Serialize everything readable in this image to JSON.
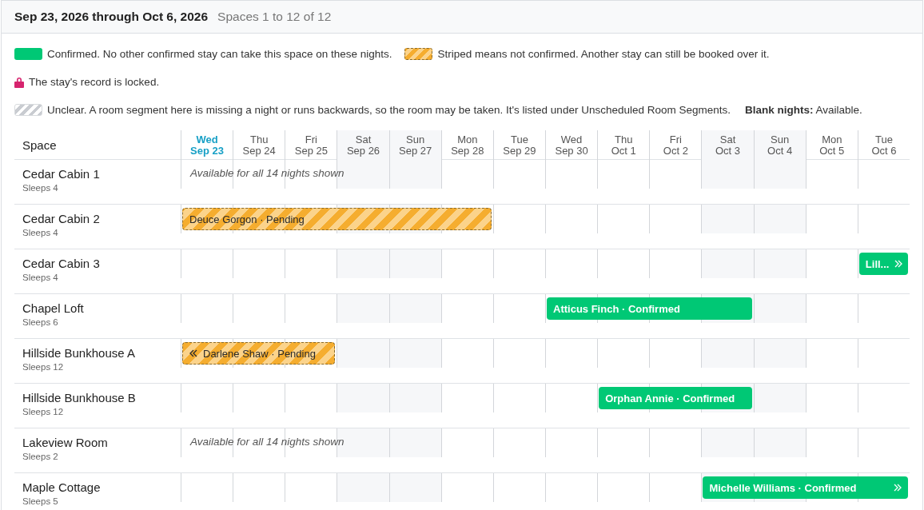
{
  "header": {
    "range": "Sep 23, 2026 through Oct 6, 2026",
    "count": "Spaces 1 to 12 of 12"
  },
  "legend": [
    [
      {
        "kind": "confirmed",
        "text": "Confirmed. No other confirmed stay can take this space on these nights."
      },
      {
        "kind": "pending",
        "text": "Striped means not confirmed. Another stay can still be booked over it."
      }
    ],
    [
      {
        "kind": "locked",
        "text": "The stay's record is locked."
      }
    ],
    [
      {
        "kind": "unclear",
        "text": "Unclear. A room segment here is missing a night or runs backwards, so the room may be taken. It's listed under Unscheduled Room Segments."
      },
      {
        "kind": "note",
        "text": "**Blank nights:** Available."
      }
    ]
  ],
  "table": {
    "space_heading": "Space",
    "days": [
      {
        "dow": "Wed",
        "date": "Sep 23",
        "weekend": false,
        "today": true
      },
      {
        "dow": "Thu",
        "date": "Sep 24",
        "weekend": false,
        "today": false
      },
      {
        "dow": "Fri",
        "date": "Sep 25",
        "weekend": false,
        "today": false
      },
      {
        "dow": "Sat",
        "date": "Sep 26",
        "weekend": true,
        "today": false
      },
      {
        "dow": "Sun",
        "date": "Sep 27",
        "weekend": true,
        "today": false
      },
      {
        "dow": "Mon",
        "date": "Sep 28",
        "weekend": false,
        "today": false
      },
      {
        "dow": "Tue",
        "date": "Sep 29",
        "weekend": false,
        "today": false
      },
      {
        "dow": "Wed",
        "date": "Sep 30",
        "weekend": false,
        "today": false
      },
      {
        "dow": "Thu",
        "date": "Oct 1",
        "weekend": false,
        "today": false
      },
      {
        "dow": "Fri",
        "date": "Oct 2",
        "weekend": false,
        "today": false
      },
      {
        "dow": "Sat",
        "date": "Oct 3",
        "weekend": true,
        "today": false
      },
      {
        "dow": "Sun",
        "date": "Oct 4",
        "weekend": true,
        "today": false
      },
      {
        "dow": "Mon",
        "date": "Oct 5",
        "weekend": false,
        "today": false
      },
      {
        "dow": "Tue",
        "date": "Oct 6",
        "weekend": false,
        "today": false
      }
    ],
    "rows": [
      {
        "name": "Cedar Cabin 1",
        "sleeps": "Sleeps 4",
        "available": "Available for all 14 nights shown",
        "nights": [
          {
            "kind": "free"
          },
          {
            "kind": "free"
          },
          {
            "kind": "free"
          },
          {
            "kind": "free"
          },
          {
            "kind": "free"
          },
          {
            "kind": "free"
          },
          {
            "kind": "free"
          },
          {
            "kind": "free"
          },
          {
            "kind": "free"
          },
          {
            "kind": "free"
          },
          {
            "kind": "free"
          },
          {
            "kind": "free"
          },
          {
            "kind": "free"
          },
          {
            "kind": "free"
          }
        ]
      },
      {
        "name": "Cedar Cabin 2",
        "sleeps": "Sleeps 4",
        "nights": [
          {
            "kind": "booked",
            "stay": {
              "label": "Deuce Gorgon · Pending",
              "kind": "pending",
              "continues_before": false,
              "continues_after": false
            }
          },
          {
            "kind": "booked"
          },
          {
            "kind": "booked"
          },
          {
            "kind": "booked"
          },
          {
            "kind": "booked"
          },
          {
            "kind": "booked"
          },
          {
            "kind": "free"
          },
          {
            "kind": "free"
          },
          {
            "kind": "free"
          },
          {
            "kind": "free"
          },
          {
            "kind": "free"
          },
          {
            "kind": "free"
          },
          {
            "kind": "free"
          },
          {
            "kind": "free"
          }
        ]
      },
      {
        "name": "Cedar Cabin 3",
        "sleeps": "Sleeps 4",
        "nights": [
          {
            "kind": "free"
          },
          {
            "kind": "free"
          },
          {
            "kind": "free"
          },
          {
            "kind": "free"
          },
          {
            "kind": "free"
          },
          {
            "kind": "free"
          },
          {
            "kind": "free"
          },
          {
            "kind": "free"
          },
          {
            "kind": "free"
          },
          {
            "kind": "free"
          },
          {
            "kind": "free"
          },
          {
            "kind": "free"
          },
          {
            "kind": "free"
          },
          {
            "kind": "booked",
            "stay": {
              "label": "Lill...",
              "kind": "confirmed",
              "continues_before": false,
              "continues_after": true
            }
          }
        ]
      },
      {
        "name": "Chapel Loft",
        "sleeps": "Sleeps 6",
        "nights": [
          {
            "kind": "free"
          },
          {
            "kind": "free"
          },
          {
            "kind": "free"
          },
          {
            "kind": "free"
          },
          {
            "kind": "free"
          },
          {
            "kind": "free"
          },
          {
            "kind": "free"
          },
          {
            "kind": "booked",
            "stay": {
              "label": "Atticus Finch · Confirmed",
              "kind": "confirmed",
              "continues_before": false,
              "continues_after": false
            }
          },
          {
            "kind": "booked"
          },
          {
            "kind": "booked"
          },
          {
            "kind": "booked"
          },
          {
            "kind": "free"
          },
          {
            "kind": "free"
          },
          {
            "kind": "free"
          }
        ]
      },
      {
        "name": "Hillside Bunkhouse A",
        "sleeps": "Sleeps 12",
        "nights": [
          {
            "kind": "booked",
            "stay": {
              "label": "Darlene Shaw · Pending",
              "kind": "pending",
              "continues_before": true,
              "continues_after": false
            }
          },
          {
            "kind": "booked"
          },
          {
            "kind": "booked"
          },
          {
            "kind": "free"
          },
          {
            "kind": "free"
          },
          {
            "kind": "free"
          },
          {
            "kind": "free"
          },
          {
            "kind": "free"
          },
          {
            "kind": "free"
          },
          {
            "kind": "free"
          },
          {
            "kind": "free"
          },
          {
            "kind": "free"
          },
          {
            "kind": "free"
          },
          {
            "kind": "free"
          }
        ]
      },
      {
        "name": "Hillside Bunkhouse B",
        "sleeps": "Sleeps 12",
        "nights": [
          {
            "kind": "free"
          },
          {
            "kind": "free"
          },
          {
            "kind": "free"
          },
          {
            "kind": "free"
          },
          {
            "kind": "free"
          },
          {
            "kind": "free"
          },
          {
            "kind": "free"
          },
          {
            "kind": "free"
          },
          {
            "kind": "booked",
            "stay": {
              "label": "Orphan Annie · Confirmed",
              "kind": "confirmed",
              "continues_before": false,
              "continues_after": false
            }
          },
          {
            "kind": "booked"
          },
          {
            "kind": "booked"
          },
          {
            "kind": "free"
          },
          {
            "kind": "free"
          },
          {
            "kind": "free"
          }
        ]
      },
      {
        "name": "Lakeview Room",
        "sleeps": "Sleeps 2",
        "available": "Available for all 14 nights shown",
        "nights": [
          {
            "kind": "free"
          },
          {
            "kind": "free"
          },
          {
            "kind": "free"
          },
          {
            "kind": "free"
          },
          {
            "kind": "free"
          },
          {
            "kind": "free"
          },
          {
            "kind": "free"
          },
          {
            "kind": "free"
          },
          {
            "kind": "free"
          },
          {
            "kind": "free"
          },
          {
            "kind": "free"
          },
          {
            "kind": "free"
          },
          {
            "kind": "free"
          },
          {
            "kind": "free"
          }
        ]
      },
      {
        "name": "Maple Cottage",
        "sleeps": "Sleeps 5",
        "nights": [
          {
            "kind": "free"
          },
          {
            "kind": "free"
          },
          {
            "kind": "free"
          },
          {
            "kind": "free"
          },
          {
            "kind": "free"
          },
          {
            "kind": "free"
          },
          {
            "kind": "free"
          },
          {
            "kind": "free"
          },
          {
            "kind": "free"
          },
          {
            "kind": "free"
          },
          {
            "kind": "booked",
            "stay": {
              "label": "Michelle Williams · Confirmed",
              "kind": "confirmed",
              "continues_before": false,
              "continues_after": true
            }
          },
          {
            "kind": "booked"
          },
          {
            "kind": "booked"
          },
          {
            "kind": "booked"
          }
        ]
      }
    ]
  }
}
